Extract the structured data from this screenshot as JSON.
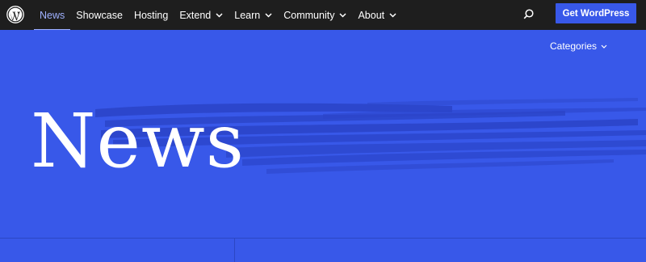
{
  "nav": {
    "logo_icon": "wordpress-logo-icon",
    "items": [
      {
        "label": "News",
        "active": true,
        "has_dropdown": false
      },
      {
        "label": "Showcase",
        "active": false,
        "has_dropdown": false
      },
      {
        "label": "Hosting",
        "active": false,
        "has_dropdown": false
      },
      {
        "label": "Extend",
        "active": false,
        "has_dropdown": true
      },
      {
        "label": "Learn",
        "active": false,
        "has_dropdown": true
      },
      {
        "label": "Community",
        "active": false,
        "has_dropdown": true
      },
      {
        "label": "About",
        "active": false,
        "has_dropdown": true
      }
    ],
    "search_icon": "search-icon",
    "cta_label": "Get WordPress"
  },
  "hero": {
    "title": "News",
    "categories_label": "Categories"
  },
  "colors": {
    "nav_bg": "#1e1e1e",
    "brand_blue": "#3858e9",
    "active_link": "#9fb1ff",
    "brush_dark": "#2b45c9",
    "text": "#ffffff"
  }
}
